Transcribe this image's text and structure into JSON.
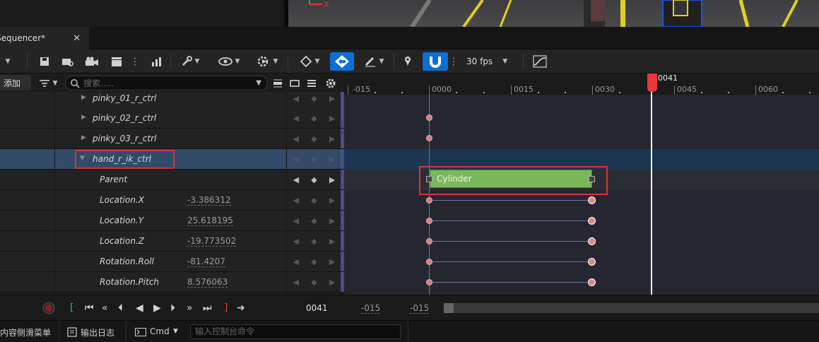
{
  "viewport": {
    "gizmo_axis": "X"
  },
  "tab": {
    "title": "Sequencer*",
    "close": "✕"
  },
  "toolbar": {
    "fps": "30 fps",
    "more": "⋮"
  },
  "left_header": {
    "add_label": "添加",
    "search_placeholder": "搜索....."
  },
  "tracks": [
    {
      "name": "pinky_01_r_ctrl",
      "expandable": true,
      "expanded": false,
      "value": ""
    },
    {
      "name": "pinky_02_r_ctrl",
      "expandable": true,
      "expanded": false,
      "value": ""
    },
    {
      "name": "pinky_03_r_ctrl",
      "expandable": true,
      "expanded": false,
      "value": ""
    },
    {
      "name": "hand_r_ik_ctrl",
      "expandable": true,
      "expanded": true,
      "selected": true,
      "value": ""
    },
    {
      "name": "Parent",
      "value": ""
    },
    {
      "name": "Location.X",
      "value": "-3.386312"
    },
    {
      "name": "Location.Y",
      "value": "25.618195"
    },
    {
      "name": "Location.Z",
      "value": "-19.773502"
    },
    {
      "name": "Rotation.Roll",
      "value": "-81.4207"
    },
    {
      "name": "Rotation.Pitch",
      "value": "8.576063"
    }
  ],
  "ruler": {
    "labels": [
      "-015",
      "0000",
      "0015",
      "0030",
      "0045",
      "0060"
    ],
    "playhead": "0041"
  },
  "section": {
    "label": "Cylinder",
    "color": "#7bb85b"
  },
  "transport": {
    "current_frame": "0041",
    "range_start": "-015",
    "range_end": "-015"
  },
  "statusbar": {
    "content_drawer": "内容侧滑菜单",
    "output_log": "输出日志",
    "cmd": "Cmd",
    "console_placeholder": "输入控制台命令"
  },
  "colors": {
    "accent": "#0d6fd6",
    "playhead": "#e8383e",
    "highlight": "#d9333a"
  }
}
